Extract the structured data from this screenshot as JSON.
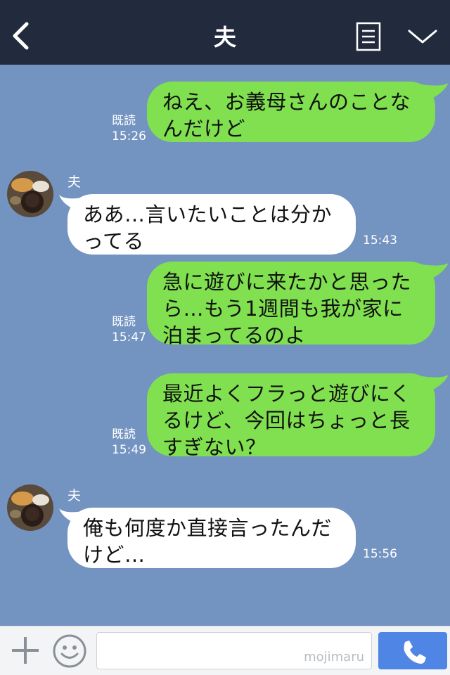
{
  "header": {
    "title": "夫",
    "back_icon": "chevron-left-icon",
    "menu_icon": "notes-icon",
    "more_icon": "chevron-down-icon",
    "bg_color": "#222b3e"
  },
  "chat": {
    "bg_color": "#7393c1",
    "sent_bubble_color": "#80e04f",
    "received_bubble_color": "#ffffff",
    "messages": [
      {
        "direction": "sent",
        "text_lines": [
          "ねえ、お義母さんのことな",
          "んだけど"
        ],
        "read_label": "既読",
        "time": "15:26"
      },
      {
        "direction": "received",
        "sender": "夫",
        "text_lines": [
          "ああ…言いたいことは分か",
          "ってる"
        ],
        "time": "15:43"
      },
      {
        "direction": "sent",
        "text_lines": [
          "急に遊びに来たかと思った",
          "ら…もう1週間も我が家に",
          "泊まってるのよ"
        ],
        "read_label": "既読",
        "time": "15:47"
      },
      {
        "direction": "sent",
        "text_lines": [
          "最近よくフラっと遊びにく",
          "るけど、今回はちょっと長",
          "すぎない？"
        ],
        "read_label": "既読",
        "time": "15:49"
      },
      {
        "direction": "received",
        "sender": "夫",
        "text_lines": [
          "俺も何度か直接言ったんだ",
          "けど…"
        ],
        "time": "15:56"
      }
    ]
  },
  "footer": {
    "plus_icon": "plus-icon",
    "emoji_icon": "smiley-icon",
    "input_value": "",
    "watermark": "mojimaru",
    "call_icon": "phone-icon",
    "call_color": "#4f86e6"
  }
}
